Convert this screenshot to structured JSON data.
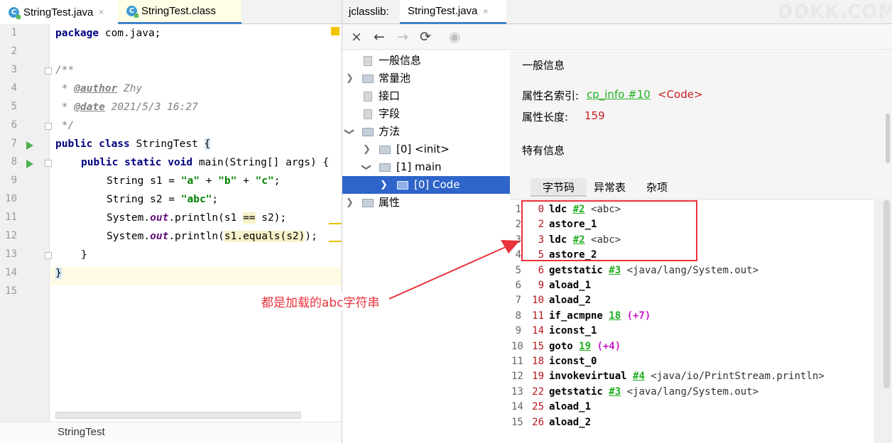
{
  "left": {
    "tabs": [
      {
        "label": "StringTest.java",
        "close": "×"
      },
      {
        "label": "StringTest.class",
        "close": ""
      }
    ],
    "line_numbers": [
      "1",
      "2",
      "3",
      "4",
      "5",
      "6",
      "7",
      "8",
      "9",
      "10",
      "11",
      "12",
      "13",
      "14",
      "15"
    ],
    "code": {
      "l1_kw": "package",
      "l1_rest": " com.java;",
      "l3": "/**",
      "l4_a": " * ",
      "l4_tag": "@author",
      "l4_b": " Zhy",
      "l5_a": " * ",
      "l5_tag": "@date",
      "l5_b": " 2021/5/3 16:27",
      "l6": " */",
      "l7_kw": "public class",
      "l7_rest": " StringTest ",
      "l7_brace": "{",
      "l8_kw": "public static void",
      "l8_rest": " main(String[] args) {",
      "l9_a": "String s1 = ",
      "l9_s1": "\"a\"",
      "l9_p1": " + ",
      "l9_s2": "\"b\"",
      "l9_p2": " + ",
      "l9_s3": "\"c\"",
      "l9_end": ";",
      "l10_a": "String s2 = ",
      "l10_s": "\"abc\"",
      "l10_end": ";",
      "l11_a": "System.",
      "l11_out": "out",
      "l11_b": ".println(s1 ",
      "l11_eq": "==",
      "l11_c": " s2);",
      "l12_a": "System.",
      "l12_out": "out",
      "l12_b": ".println(",
      "l12_hl": "s1.equals(s2)",
      "l12_c": ");",
      "l13": "}",
      "l14": "}"
    },
    "status": "StringTest"
  },
  "annotation": "都是加载的abc字符串",
  "right": {
    "window_label": "jclasslib:",
    "tab": {
      "label": "StringTest.java",
      "close": "×"
    },
    "watermark": "DDKK.COM",
    "toolbar": {
      "close": "×",
      "back": "←",
      "forward": "→",
      "refresh": "⟳",
      "web": "◉"
    },
    "tree": [
      {
        "label": "一般信息"
      },
      {
        "label": "常量池"
      },
      {
        "label": "接口"
      },
      {
        "label": "字段"
      },
      {
        "label": "方法"
      },
      {
        "label": "[0] <init>"
      },
      {
        "label": "[1] main"
      },
      {
        "label": "[0] Code"
      },
      {
        "label": "属性"
      }
    ],
    "details": {
      "general_heading": "一般信息",
      "name_index_label": "属性名索引:",
      "name_index_link": "cp_info #10",
      "name_index_value": "<Code>",
      "length_label": "属性长度:",
      "length_value": "159",
      "specific_heading": "特有信息",
      "subtabs": [
        "字节码",
        "异常表",
        "杂项"
      ]
    },
    "bytecode": [
      {
        "n": "1",
        "off": "0",
        "op": "ldc",
        "ref": "#2",
        "cmt": "<abc>",
        "jmp": ""
      },
      {
        "n": "2",
        "off": "2",
        "op": "astore_1",
        "ref": "",
        "cmt": "",
        "jmp": ""
      },
      {
        "n": "3",
        "off": "3",
        "op": "ldc",
        "ref": "#2",
        "cmt": "<abc>",
        "jmp": ""
      },
      {
        "n": "4",
        "off": "5",
        "op": "astore_2",
        "ref": "",
        "cmt": "",
        "jmp": ""
      },
      {
        "n": "5",
        "off": "6",
        "op": "getstatic",
        "ref": "#3",
        "cmt": "<java/lang/System.out>",
        "jmp": ""
      },
      {
        "n": "6",
        "off": "9",
        "op": "aload_1",
        "ref": "",
        "cmt": "",
        "jmp": ""
      },
      {
        "n": "7",
        "off": "10",
        "op": "aload_2",
        "ref": "",
        "cmt": "",
        "jmp": ""
      },
      {
        "n": "8",
        "off": "11",
        "op": "if_acmpne",
        "ref": "18",
        "cmt": "",
        "jmp": "(+7)"
      },
      {
        "n": "9",
        "off": "14",
        "op": "iconst_1",
        "ref": "",
        "cmt": "",
        "jmp": ""
      },
      {
        "n": "10",
        "off": "15",
        "op": "goto",
        "ref": "19",
        "cmt": "",
        "jmp": "(+4)"
      },
      {
        "n": "11",
        "off": "18",
        "op": "iconst_0",
        "ref": "",
        "cmt": "",
        "jmp": ""
      },
      {
        "n": "12",
        "off": "19",
        "op": "invokevirtual",
        "ref": "#4",
        "cmt": "<java/io/PrintStream.println>",
        "jmp": ""
      },
      {
        "n": "13",
        "off": "22",
        "op": "getstatic",
        "ref": "#3",
        "cmt": "<java/lang/System.out>",
        "jmp": ""
      },
      {
        "n": "14",
        "off": "25",
        "op": "aload_1",
        "ref": "",
        "cmt": "",
        "jmp": ""
      },
      {
        "n": "15",
        "off": "26",
        "op": "aload_2",
        "ref": "",
        "cmt": "",
        "jmp": ""
      }
    ]
  },
  "colors": {
    "annotation": "#e8323c",
    "selection": "#2f65ca",
    "link": "#1fae1f",
    "offset": "#b4141e",
    "jump": "#c81ec8"
  }
}
